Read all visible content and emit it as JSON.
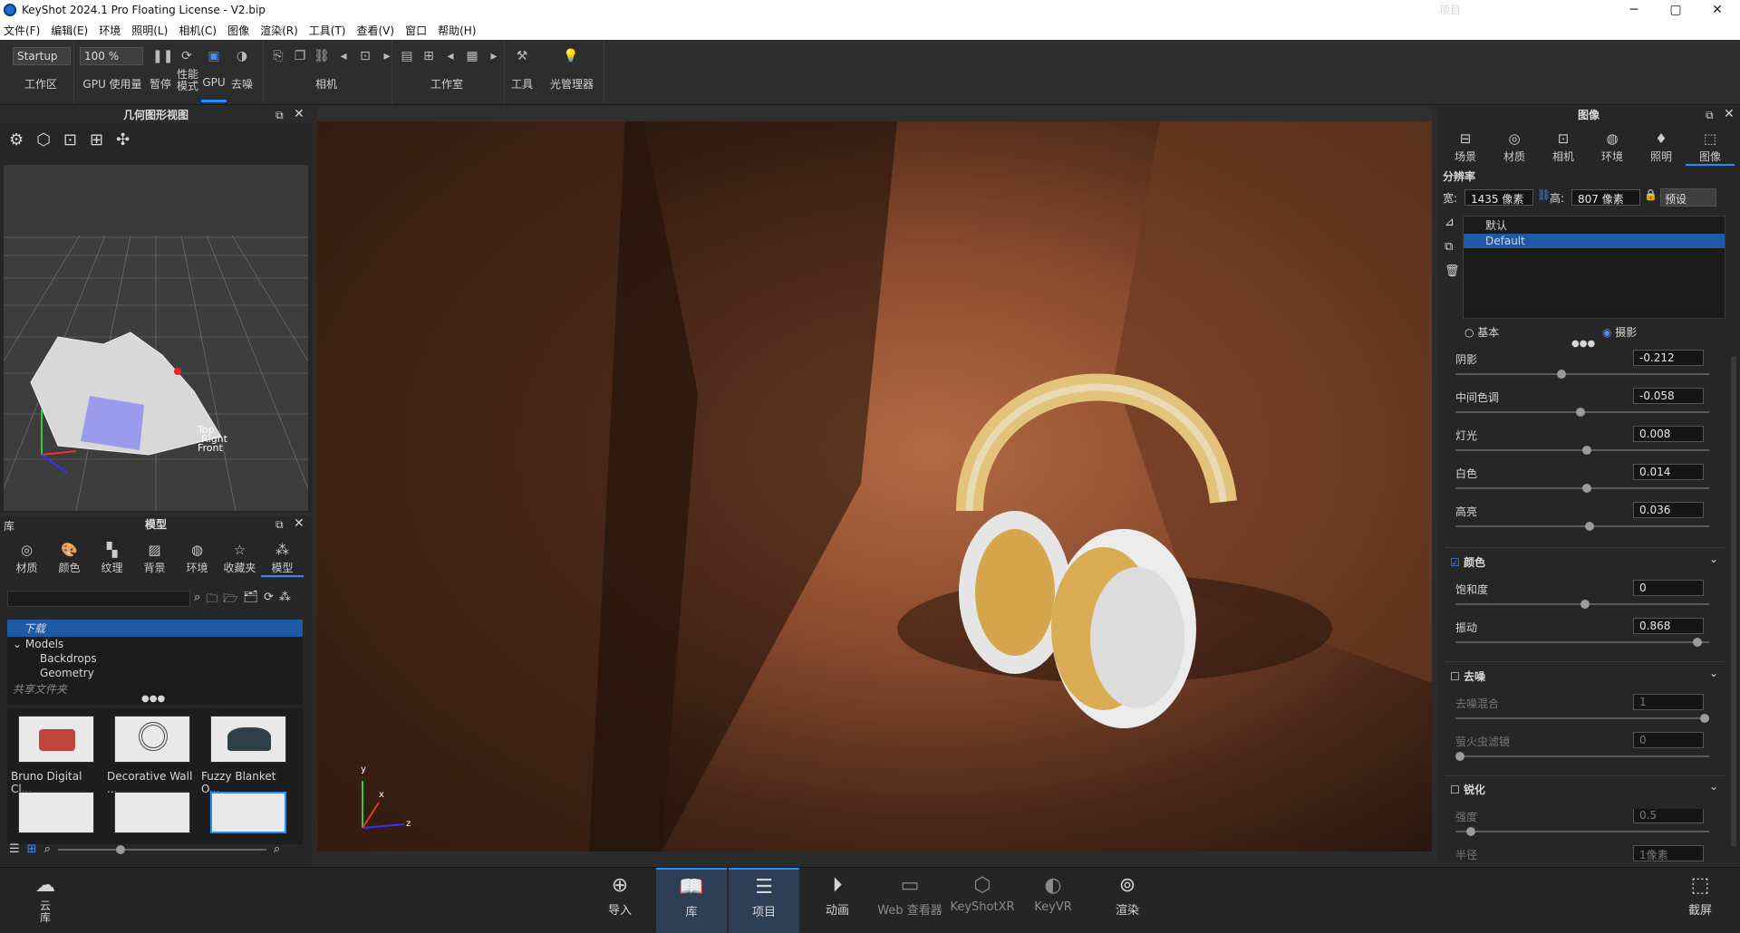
{
  "window": {
    "title": "KeyShot 2024.1 Pro Floating License  - V2.bip",
    "minimize": "─",
    "maximize": "▢",
    "close": "✕"
  },
  "menu": [
    "文件(F)",
    "编辑(E)",
    "环境",
    "照明(L)",
    "相机(C)",
    "图像",
    "渲染(R)",
    "工具(T)",
    "查看(V)",
    "窗口",
    "帮助(H)"
  ],
  "ribbon": {
    "workspace": {
      "value": "Startup",
      "label": "工作区"
    },
    "zoom": {
      "value": "100 %"
    },
    "gpu_usage": "GPU 使用量",
    "pause": "暂停",
    "perf": "性能\n模式",
    "gpu": "GPU",
    "denoise": "去噪",
    "camera": "相机",
    "studio": "工作室",
    "tools": "工具",
    "light_manager": "光管理器"
  },
  "geometry_view": {
    "title": "几何图形视图",
    "label_top": "Top",
    "label_right": "Right",
    "label_front": "Front"
  },
  "library": {
    "title": "库",
    "panel": "模型",
    "tabs": [
      "材质",
      "颜色",
      "纹理",
      "背景",
      "环境",
      "收藏夹",
      "模型"
    ],
    "tree": [
      "下载",
      "Models",
      "Backdrops",
      "Geometry",
      "共享文件夹"
    ],
    "thumbs": [
      "Bruno Digital Cl...",
      "Decorative Wall ...",
      "Fuzzy Blanket O..."
    ]
  },
  "viewport": {
    "axis_x": "x",
    "axis_y": "y",
    "axis_z": "z"
  },
  "project": {
    "title": "项目",
    "panel": "图像",
    "tabs": [
      "场景",
      "材质",
      "相机",
      "环境",
      "照明",
      "图像"
    ],
    "resolution_label": "分辨率",
    "width_label": "宽:",
    "width": "1435 像素",
    "height_label": "高:",
    "height": "807 像素",
    "preset": "预设",
    "presets": [
      "默认",
      "Default"
    ],
    "mode_basic": "基本",
    "mode_photo": "摄影",
    "tone": [
      {
        "label": "阴影",
        "value": "-0.212",
        "pos": 0.42
      },
      {
        "label": "中间色调",
        "value": "-0.058",
        "pos": 0.48
      },
      {
        "label": "灯光",
        "value": "0.008",
        "pos": 0.5
      },
      {
        "label": "白色",
        "value": "0.014",
        "pos": 0.5
      },
      {
        "label": "高亮",
        "value": "0.036",
        "pos": 0.51
      }
    ],
    "color_section": "颜色",
    "saturation_label": "饱和度",
    "saturation": "0",
    "vibrance_label": "振动",
    "vibrance": "0.868",
    "denoise_section": "去噪",
    "denoise_mix_label": "去噪混合",
    "denoise_mix": "1",
    "firefly_label": "萤火虫滤镜",
    "firefly": "0",
    "sharpen_section": "锐化",
    "strength_label": "强度",
    "strength": "0.5",
    "radius_label": "半径",
    "radius": "1像素"
  },
  "bottom": [
    "云\n库",
    "导入",
    "库",
    "项目",
    "动画",
    "Web 查看器",
    "KeyShotXR",
    "KeyVR",
    "渲染",
    "截屏"
  ]
}
